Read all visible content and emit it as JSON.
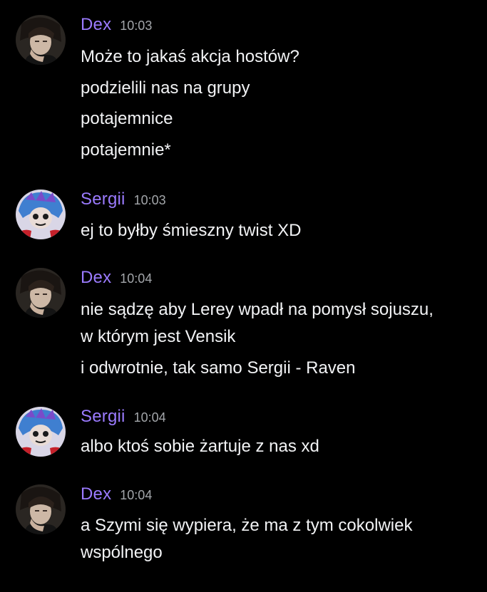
{
  "colors": {
    "background": "#000000",
    "author_name": "#9b7bff",
    "timestamp": "#a3a6aa",
    "message_text": "#f2f3f5"
  },
  "messages": [
    {
      "author": "Dex",
      "time": "10:03",
      "avatar_icon": "dex-avatar-icon",
      "lines": [
        "Może to jakaś akcja hostów?",
        "podzielili nas na grupy",
        "potajemnice",
        "potajemnie*"
      ]
    },
    {
      "author": "Sergii",
      "time": "10:03",
      "avatar_icon": "sergii-avatar-icon",
      "lines": [
        "ej to byłby śmieszny twist XD"
      ]
    },
    {
      "author": "Dex",
      "time": "10:04",
      "avatar_icon": "dex-avatar-icon",
      "lines": [
        "nie sądzę aby Lerey wpadł na pomysł sojuszu,",
        "w którym jest Vensik",
        "i odwrotnie, tak samo Sergii - Raven"
      ]
    },
    {
      "author": "Sergii",
      "time": "10:04",
      "avatar_icon": "sergii-avatar-icon",
      "lines": [
        "albo ktoś sobie żartuje z nas xd"
      ]
    },
    {
      "author": "Dex",
      "time": "10:04",
      "avatar_icon": "dex-avatar-icon",
      "lines": [
        "a Szymi się wypiera, że ma z tym cokolwiek",
        "wspólnego"
      ]
    }
  ]
}
